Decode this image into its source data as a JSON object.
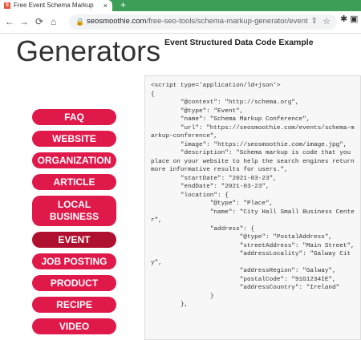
{
  "browser": {
    "tab_title": "Free Event Schema Markup Gene",
    "tab_favicon": "S",
    "tab_close": "×",
    "new_tab": "+",
    "url_host": "seosmoothie.com",
    "url_path": "/free-seo-tools/schema-markup-generator/event"
  },
  "icons": {
    "back": "←",
    "forward": "→",
    "reload": "⟳",
    "home": "⌂",
    "lock": "🔒",
    "share": "⇪",
    "star": "☆",
    "extension": "✱",
    "sidepanel": "▣"
  },
  "sidebar": {
    "title": "Generators",
    "items": [
      {
        "label": "FAQ"
      },
      {
        "label": "WEBSITE"
      },
      {
        "label": "ORGANIZATION"
      },
      {
        "label": "ARTICLE"
      },
      {
        "label": "LOCAL BUSINESS"
      },
      {
        "label": "EVENT"
      },
      {
        "label": "JOB POSTING"
      },
      {
        "label": "PRODUCT"
      },
      {
        "label": "RECIPE"
      },
      {
        "label": "VIDEO"
      }
    ]
  },
  "main": {
    "title": "Event Structured Data Code Example",
    "code": "<script type='application/ld+json'>\n{\n        \"@context\": \"http://schema.org\",\n        \"@type\": \"Event\",\n        \"name\": \"Schema Markup Conference\",\n        \"url\": \"https://seosmoothie.com/events/schema-markup-conference\",\n        \"image\": \"https://seosmoothie.com/image.jpg\",\n        \"description\": \"Schema markup is code that you place on your website to help the search engines return more informative results for users.\",\n        \"startDate\": \"2021-03-23\",\n        \"endDate\": \"2021-03-23\",\n        \"location\": {\n                \"@type\": \"Place\",\n                \"name\": \"City Hall Small Business Center\",\n                \"address\": {\n                        \"@type\": \"PostalAddress\",\n                        \"streetAddress\": \"Main Street\",\n                        \"addressLocality\": \"Galway City\",\n                        \"addressRegion\": \"Galway\",\n                        \"postalCode\": \"91G1234IE\",\n                        \"addressCountry\": \"Ireland\"\n                }\n        },"
  },
  "colors": {
    "accent": "#e0194b",
    "accent_active": "#b0102f",
    "tabbar": "#3c9e57"
  }
}
